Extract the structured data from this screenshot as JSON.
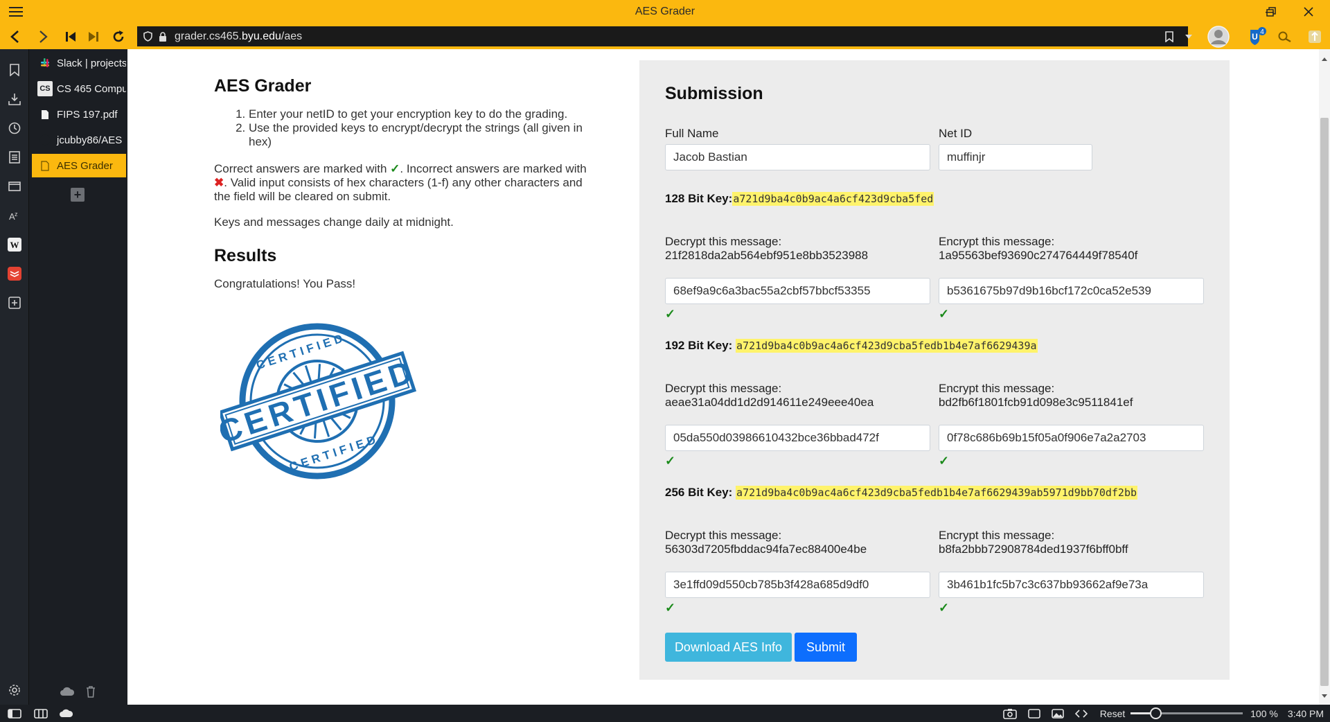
{
  "window": {
    "title": "AES Grader"
  },
  "nav": {
    "url_plain": "grader.cs465.",
    "url_host": "byu.edu",
    "url_path": "/aes",
    "notification_count": "4"
  },
  "tabs": [
    {
      "label": "Slack | projects",
      "icon": "slack-icon"
    },
    {
      "label": "CS 465 Compu",
      "icon": "cs-icon"
    },
    {
      "label": "FIPS 197.pdf",
      "icon": "document-icon"
    },
    {
      "label": "jcubby86/AES",
      "icon": "github-icon"
    },
    {
      "label": "AES Grader",
      "icon": "document-icon"
    }
  ],
  "left": {
    "heading": "AES Grader",
    "steps": [
      "Enter your netID to get your encryption key to do the grading.",
      "Use the provided keys to encrypt/decrypt the strings (all given in hex)"
    ],
    "correct_text_1": "Correct answers are marked with ",
    "correct_mark": "✓",
    "correct_text_2": ". Incorrect answers are marked with ",
    "incorrect_mark": "✖",
    "correct_text_3": ". Valid input consists of hex characters (1-f) any other characters and the field will be cleared on submit.",
    "keys_note": "Keys and messages change daily at midnight.",
    "results_heading": "Results",
    "pass_message": "Congratulations! You Pass!"
  },
  "certificate": {
    "word": "CERTIFIED",
    "ring_top": "CERTIFIED",
    "ring_bottom": "CERTIFIED",
    "color": "#1f6fb2"
  },
  "submission": {
    "heading": "Submission",
    "full_name_label": "Full Name",
    "full_name_value": "Jacob Bastian",
    "netid_label": "Net ID",
    "netid_value": "muffinjr",
    "check_mark": "✓",
    "keys": [
      {
        "label": "128 Bit Key:",
        "key": "a721d9ba4c0b9ac4a6cf423d9cba5fed",
        "decrypt_label": "Decrypt this message:",
        "decrypt_msg": "21f2818da2ab564ebf951e8bb3523988",
        "decrypt_answer": "68ef9a9c6a3bac55a2cbf57bbcf53355",
        "encrypt_label": "Encrypt this message:",
        "encrypt_msg": "1a95563bef93690c274764449f78540f",
        "encrypt_answer": "b5361675b97d9b16bcf172c0ca52e539"
      },
      {
        "label": "192 Bit Key: ",
        "key": "a721d9ba4c0b9ac4a6cf423d9cba5fedb1b4e7af6629439a",
        "decrypt_label": "Decrypt this message:",
        "decrypt_msg": "aeae31a04dd1d2d914611e249eee40ea",
        "decrypt_answer": "05da550d03986610432bce36bbad472f",
        "encrypt_label": "Encrypt this message:",
        "encrypt_msg": "bd2fb6f1801fcb91d098e3c9511841ef",
        "encrypt_answer": "0f78c686b69b15f05a0f906e7a2a2703"
      },
      {
        "label": "256 Bit Key: ",
        "key": "a721d9ba4c0b9ac4a6cf423d9cba5fedb1b4e7af6629439ab5971d9bb70df2bb",
        "decrypt_label": "Decrypt this message:",
        "decrypt_msg": "56303d7205fbddac94fa7ec88400e4be",
        "decrypt_answer": "3e1ffd09d550cb785b3f428a685d9df0",
        "encrypt_label": "Encrypt this message:",
        "encrypt_msg": "b8fa2bbb72908784ded1937f6bff0bff",
        "encrypt_answer": "3b461b1fc5b7c3c637bb93662af9e73a"
      }
    ],
    "download_button": "Download AES Info",
    "submit_button": "Submit",
    "colors": {
      "download": "#3fb6dd",
      "submit": "#0d6efd"
    }
  },
  "statusbar": {
    "reset_label": "Reset",
    "zoom": "100 %",
    "zoom_fraction": 0.22,
    "time": "3:40 PM"
  },
  "theme": {
    "accent": "#fbb80f",
    "dark_panel": "#1b1e23",
    "success": "#1a8a1a"
  }
}
